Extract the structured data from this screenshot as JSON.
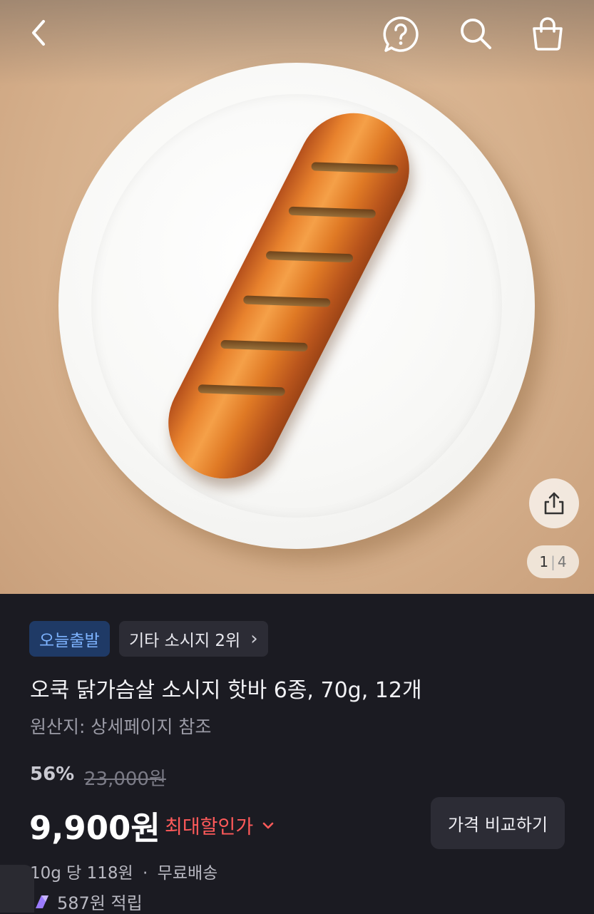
{
  "header": {
    "back_icon": "chevron-left-icon",
    "help_icon": "question-bubble-icon",
    "search_icon": "search-icon",
    "cart_icon": "shopping-bag-icon"
  },
  "gallery": {
    "current": "1",
    "total": "4",
    "separator": "|",
    "share_icon": "share-icon"
  },
  "badges": {
    "delivery": "오늘출발",
    "rank": "기타 소시지 2위",
    "rank_chevron": "›"
  },
  "product": {
    "title": "오쿡 닭가슴살 소시지 핫바 6종, 70g, 12개",
    "origin": "원산지: 상세페이지 참조"
  },
  "pricing": {
    "discount": "56%",
    "original_price": "23,000원",
    "price": "9,900원",
    "max_discount_label": "최대할인가",
    "compare_button": "가격 비교하기",
    "unit_price": "10g 당 118원",
    "dot": "·",
    "shipping": "무료배송",
    "points": "587원 적립"
  },
  "colors": {
    "accent_red": "#ff5a5a",
    "badge_blue": "#7db3ff",
    "background": "#1b1b22"
  }
}
